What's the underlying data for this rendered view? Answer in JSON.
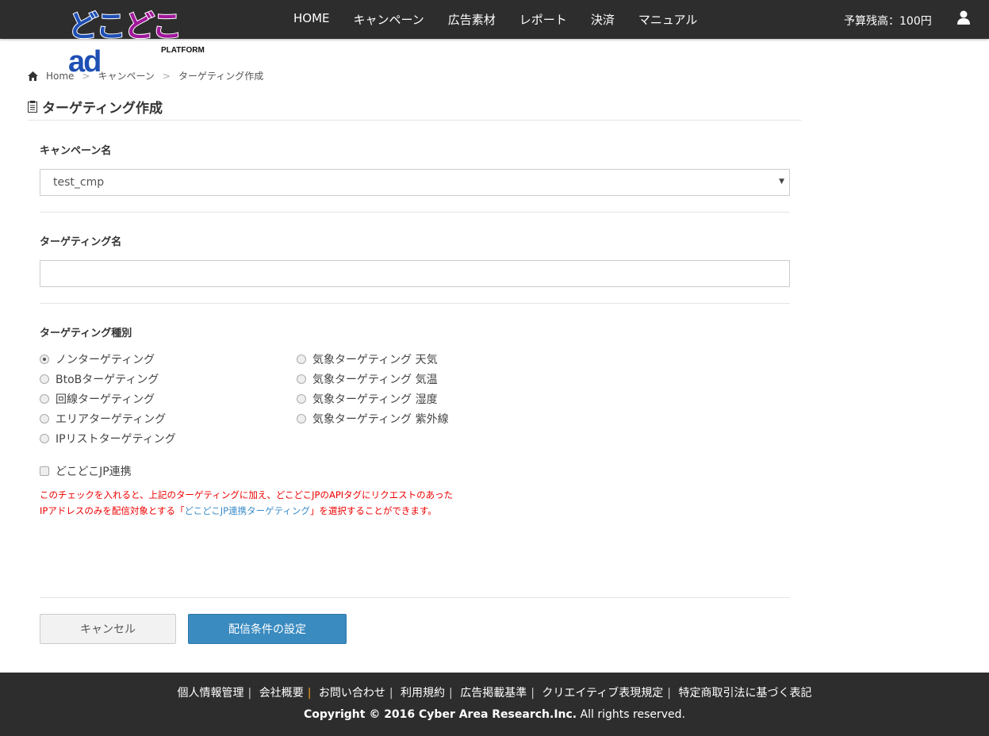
{
  "header": {
    "logo_text": "どこどこad",
    "logo_sub": "PLATFORM",
    "menu": [
      "HOME",
      "キャンペーン",
      "広告素材",
      "レポート",
      "決済",
      "マニュアル"
    ],
    "budget": "予算残高：100円"
  },
  "breadcrumb": [
    "Home",
    "キャンペーン",
    "ターゲティング作成"
  ],
  "page_title": "ターゲティング作成",
  "form": {
    "campaign_label": "キャンペーン名",
    "campaign_value": "test_cmp",
    "targeting_name_label": "ターゲティング名",
    "targeting_name_value": "",
    "type_label": "ターゲティング種別",
    "types_left": [
      "ノンターゲティング",
      "BtoBターゲティング",
      "回線ターゲティング",
      "エリアターゲティング",
      "IPリストターゲティング"
    ],
    "types_right": [
      "気象ターゲティング 天気",
      "気象ターゲティング 気温",
      "気象ターゲティング 湿度",
      "気象ターゲティング 紫外線"
    ],
    "selected": "ノンターゲティング",
    "jp_label": "どこどこJP連携",
    "jp_checked": false,
    "note_1": "このチェックを入れると、上記のターゲティングに加え、どこどこJPのAPIタグにリクエストのあった",
    "note_2a": "IPアドレスのみを配信対象とする「",
    "note_2b": "どこどこJP連携ターゲティング",
    "note_2c": "」を選択することができます。",
    "cancel": "キャンセル",
    "submit": "配信条件の設定"
  },
  "footer": {
    "links": [
      "個人情報管理",
      "会社概要",
      "お問い合わせ",
      "利用規約",
      "広告掲載基準",
      "クリエイティブ表現規定",
      "特定商取引法に基づく表記"
    ],
    "copyright_bold": "Copyright © 2016 Cyber Area Research.Inc.",
    "copyright_rest": " All rights reserved."
  }
}
